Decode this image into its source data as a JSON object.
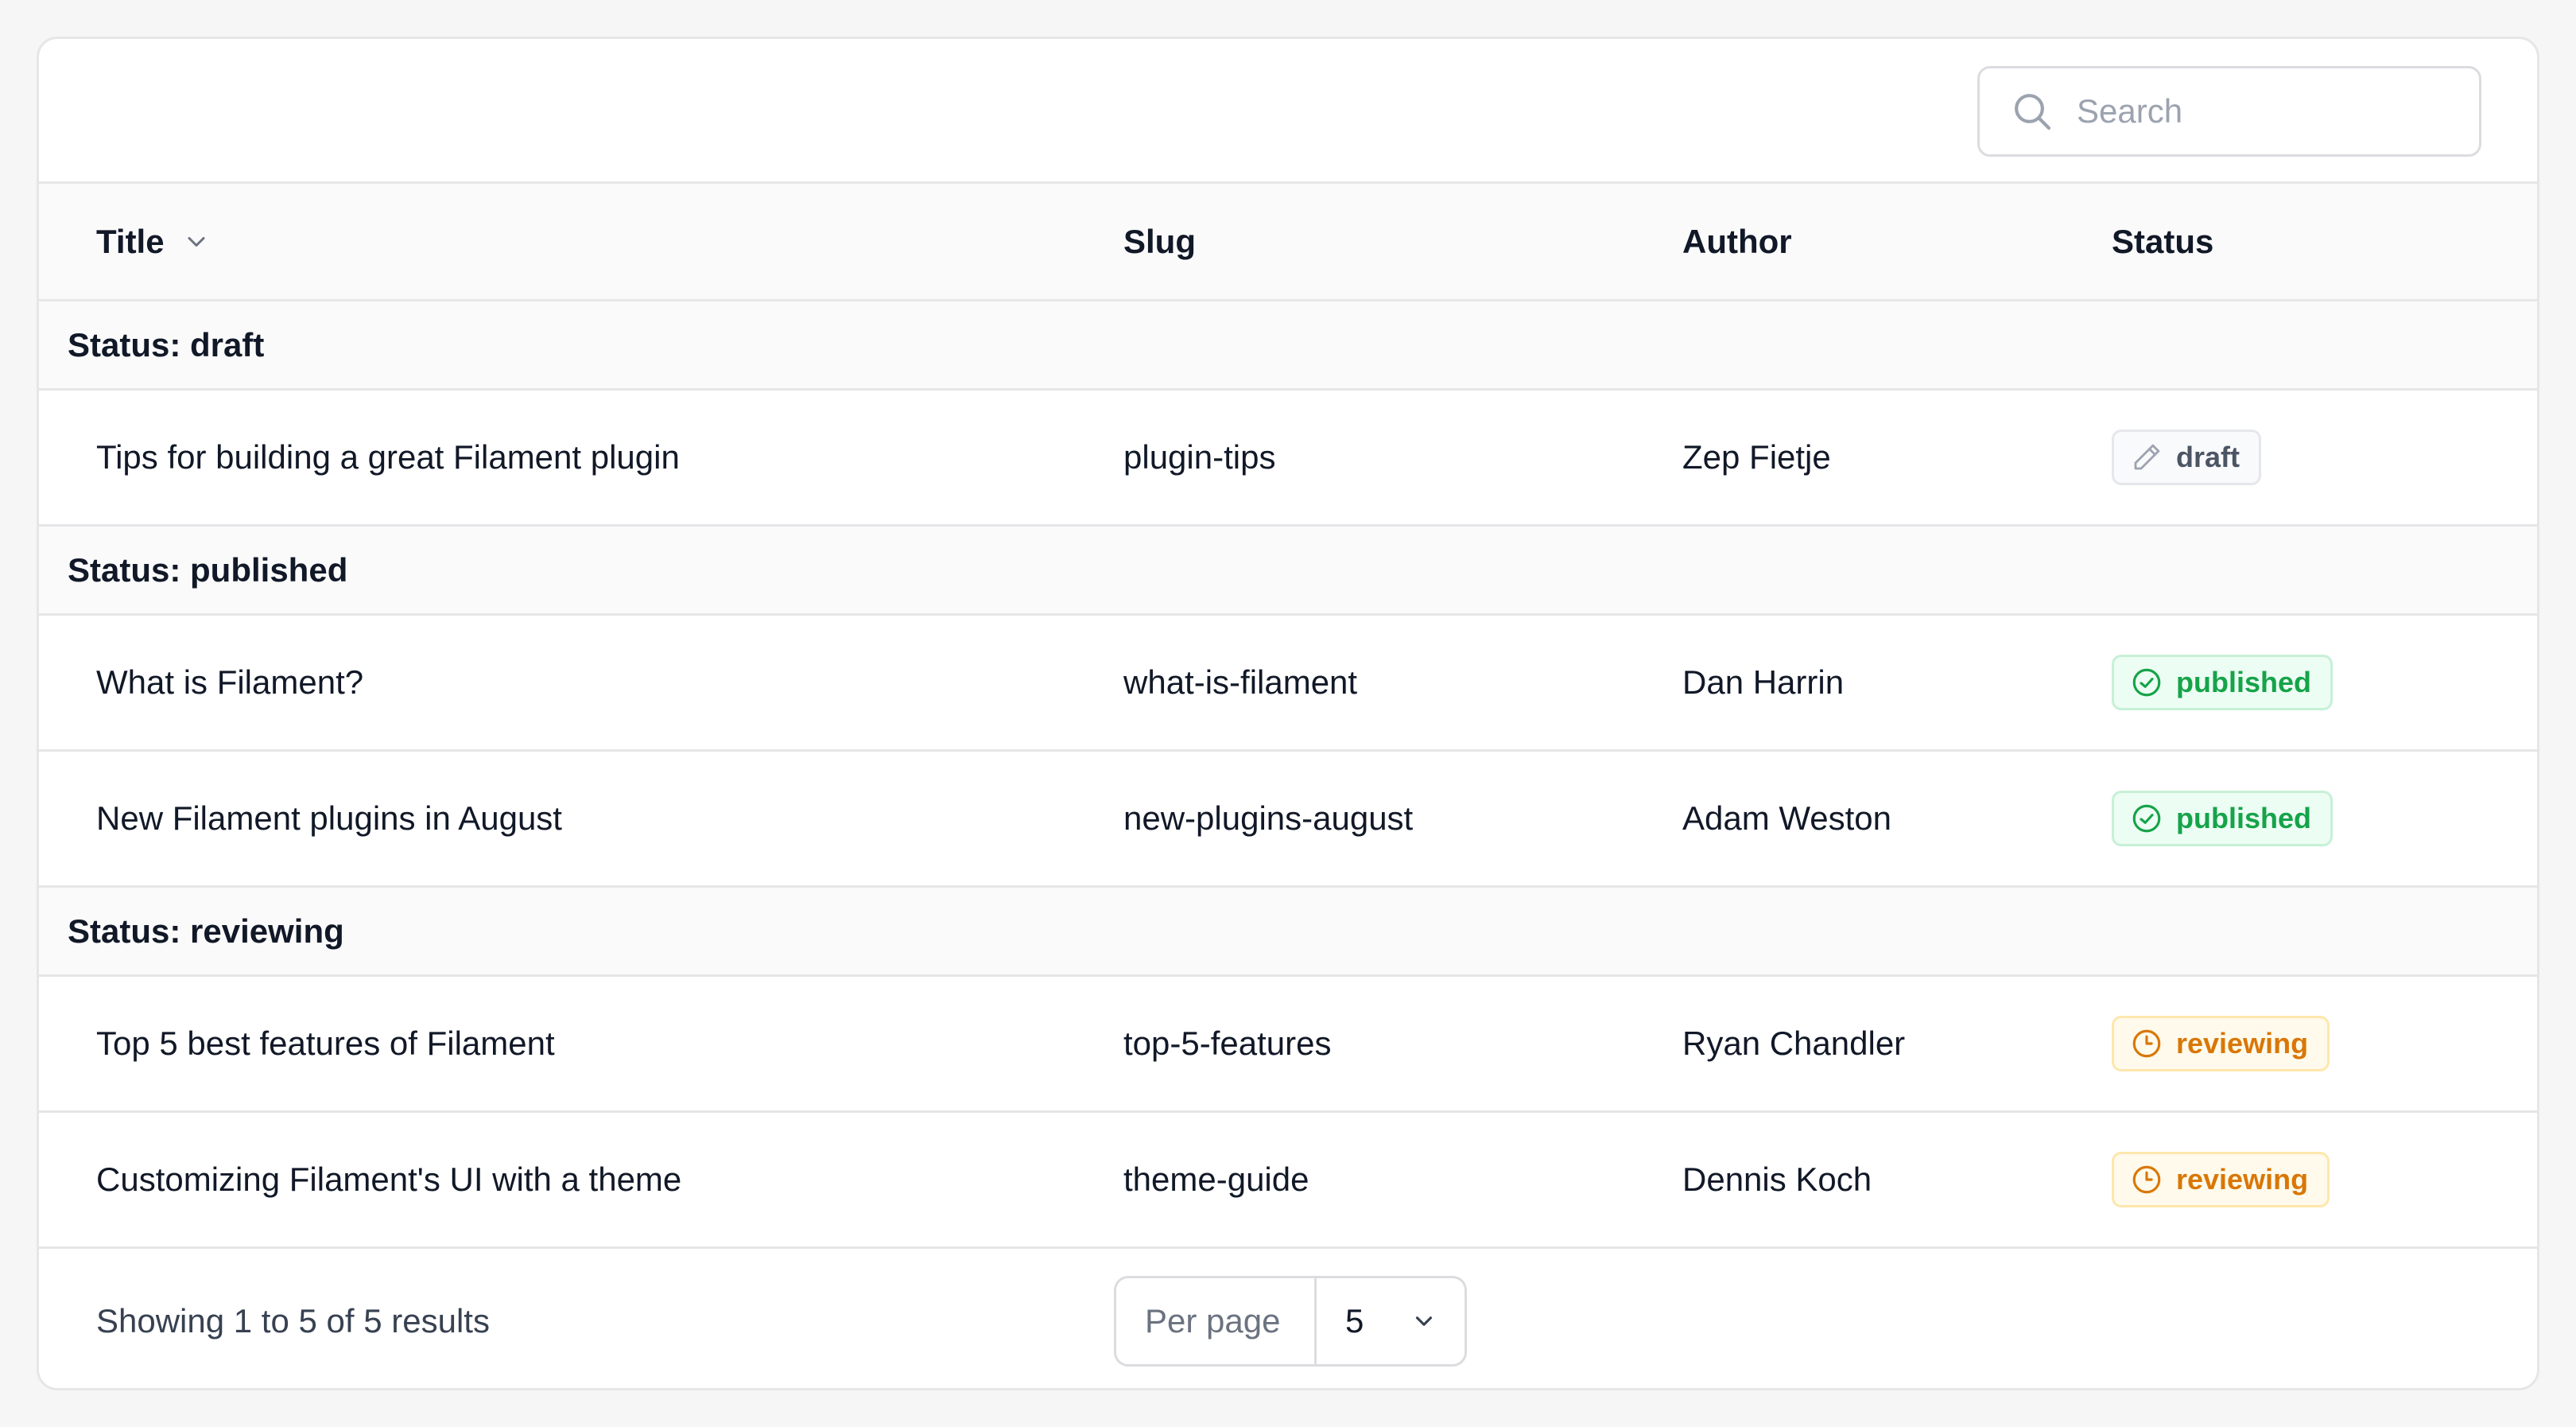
{
  "search": {
    "placeholder": "Search"
  },
  "columns": {
    "title": "Title",
    "slug": "Slug",
    "author": "Author",
    "status": "Status"
  },
  "groups": [
    {
      "label": "Status: draft",
      "rows": [
        {
          "title": "Tips for building a great Filament plugin",
          "slug": "plugin-tips",
          "author": "Zep Fietje",
          "status": "draft"
        }
      ]
    },
    {
      "label": "Status: published",
      "rows": [
        {
          "title": "What is Filament?",
          "slug": "what-is-filament",
          "author": "Dan Harrin",
          "status": "published"
        },
        {
          "title": "New Filament plugins in August",
          "slug": "new-plugins-august",
          "author": "Adam Weston",
          "status": "published"
        }
      ]
    },
    {
      "label": "Status: reviewing",
      "rows": [
        {
          "title": "Top 5 best features of Filament",
          "slug": "top-5-features",
          "author": "Ryan Chandler",
          "status": "reviewing"
        },
        {
          "title": "Customizing Filament's UI with a theme",
          "slug": "theme-guide",
          "author": "Dennis Koch",
          "status": "reviewing"
        }
      ]
    }
  ],
  "footer": {
    "showing": "Showing 1 to 5 of 5 results",
    "per_page_label": "Per page",
    "per_page_value": "5"
  },
  "colors": {
    "published": "#16a34a",
    "reviewing": "#d97706",
    "draft": "#4b5563"
  }
}
